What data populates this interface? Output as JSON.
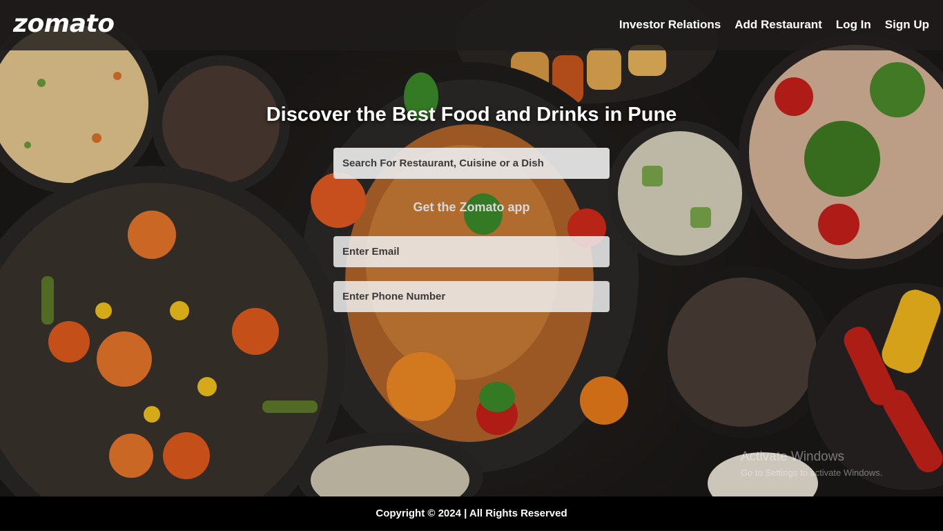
{
  "brand": {
    "logo_text": "zomato"
  },
  "nav": {
    "items": [
      "Investor Relations",
      "Add Restaurant",
      "Log In",
      "Sign Up"
    ]
  },
  "hero": {
    "headline": "Discover the Best Food and Drinks in Pune",
    "search_placeholder": "Search For Restaurant, Cuisine or a Dish",
    "app_text": "Get the Zomato app",
    "email_placeholder": "Enter Email",
    "phone_placeholder": "Enter Phone Number"
  },
  "watermark": {
    "title": "Activate Windows",
    "subtitle": "Go to Settings to activate Windows."
  },
  "footer": {
    "text": "Copyright © 2024 | All Rights Reserved"
  },
  "colors": {
    "topbar": "#1e1c1b",
    "footer": "#000000",
    "text": "#ffffff"
  }
}
